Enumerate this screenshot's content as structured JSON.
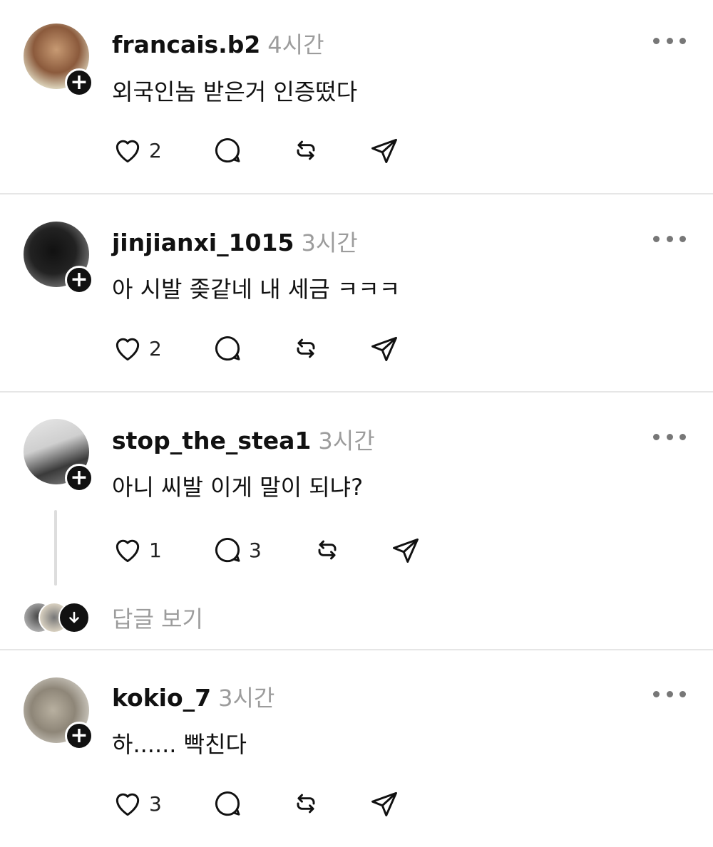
{
  "posts": [
    {
      "username": "francais.b2",
      "time": "4시간",
      "text": "외국인놈 받은거 인증떴다",
      "likes": "2",
      "replies": ""
    },
    {
      "username": "jinjianxi_1015",
      "time": "3시간",
      "text": "아 시발 좆같네 내 세금 ㅋㅋㅋ",
      "likes": "2",
      "replies": ""
    },
    {
      "username": "stop_the_stea1",
      "time": "3시간",
      "text": "아니 씨발 이게 말이 되냐?",
      "likes": "1",
      "replies": "3",
      "view_replies_label": "답글 보기"
    },
    {
      "username": "kokio_7",
      "time": "3시간",
      "text": "하...... 빡친다",
      "likes": "3",
      "replies": ""
    }
  ],
  "icons": {
    "follow": "plus-icon",
    "like": "heart-icon",
    "reply": "comment-icon",
    "repost": "repost-icon",
    "share": "send-icon",
    "more": "more-icon",
    "expand": "arrow-down-icon"
  },
  "colors": {
    "text": "#111111",
    "muted": "#9c9c9c",
    "divider": "#e6e6e6"
  }
}
